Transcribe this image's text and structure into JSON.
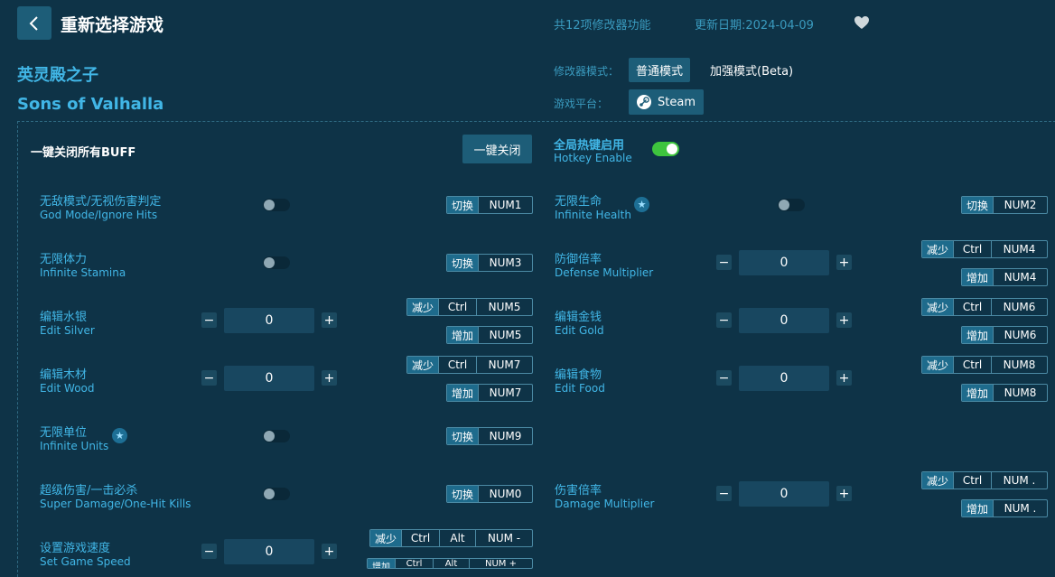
{
  "header": {
    "title": "重新选择游戏",
    "feature_count": "共12项修改器功能",
    "update_date": "更新日期:2024-04-09"
  },
  "game": {
    "name_cn": "英灵殿之子",
    "name_en": "Sons of Valhalla"
  },
  "modes": {
    "label": "修改器模式：",
    "normal": "普通模式",
    "enhanced": "加强模式(Beta)",
    "platform_label": "游戏平台：",
    "platform": "Steam"
  },
  "global": {
    "close_all_label": "一键关闭所有BUFF",
    "close_all_button": "一键关闭",
    "hotkey_cn": "全局热键启用",
    "hotkey_en": "Hotkey Enable",
    "hotkey_enabled": true
  },
  "items": {
    "god_mode": {
      "cn": "无敌模式/无视伤害判定",
      "en": "God Mode/Ignore Hits",
      "action": "切换",
      "key": "NUM1"
    },
    "infinite_health": {
      "cn": "无限生命",
      "en": "Infinite Health",
      "action": "切换",
      "key": "NUM2"
    },
    "infinite_stamina": {
      "cn": "无限体力",
      "en": "Infinite Stamina",
      "action": "切换",
      "key": "NUM3"
    },
    "defense_mult": {
      "cn": "防御倍率",
      "en": "Defense Multiplier",
      "value": "0",
      "dec": "减少",
      "inc": "增加",
      "mod": "Ctrl",
      "key_dec": "NUM4",
      "key_inc": "NUM4"
    },
    "edit_silver": {
      "cn": "编辑水银",
      "en": "Edit Silver",
      "value": "0",
      "dec": "减少",
      "inc": "增加",
      "mod": "Ctrl",
      "key_dec": "NUM5",
      "key_inc": "NUM5"
    },
    "edit_gold": {
      "cn": "编辑金钱",
      "en": "Edit Gold",
      "value": "0",
      "dec": "减少",
      "inc": "增加",
      "mod": "Ctrl",
      "key_dec": "NUM6",
      "key_inc": "NUM6"
    },
    "edit_wood": {
      "cn": "编辑木材",
      "en": "Edit Wood",
      "value": "0",
      "dec": "减少",
      "inc": "增加",
      "mod": "Ctrl",
      "key_dec": "NUM7",
      "key_inc": "NUM7"
    },
    "edit_food": {
      "cn": "编辑食物",
      "en": "Edit Food",
      "value": "0",
      "dec": "减少",
      "inc": "增加",
      "mod": "Ctrl",
      "key_dec": "NUM8",
      "key_inc": "NUM8"
    },
    "infinite_units": {
      "cn": "无限单位",
      "en": "Infinite Units",
      "action": "切换",
      "key": "NUM9"
    },
    "super_damage": {
      "cn": "超级伤害/一击必杀",
      "en": "Super Damage/One-Hit Kills",
      "action": "切换",
      "key": "NUM0"
    },
    "damage_mult": {
      "cn": "伤害倍率",
      "en": "Damage Multiplier",
      "value": "0",
      "dec": "减少",
      "inc": "增加",
      "mod": "Ctrl",
      "key_dec": "NUM .",
      "key_inc": "NUM ."
    },
    "game_speed": {
      "cn": "设置游戏速度",
      "en": "Set Game Speed",
      "value": "0",
      "dec": "减少",
      "inc": "增加",
      "mod": "Ctrl",
      "mod2": "Alt",
      "key_dec": "NUM -",
      "key_inc": "NUM +"
    }
  },
  "colors": {
    "background": "#0e3347",
    "accent": "#41b6e6",
    "button": "#1d5d78",
    "toggle_on": "#3ec43e"
  }
}
